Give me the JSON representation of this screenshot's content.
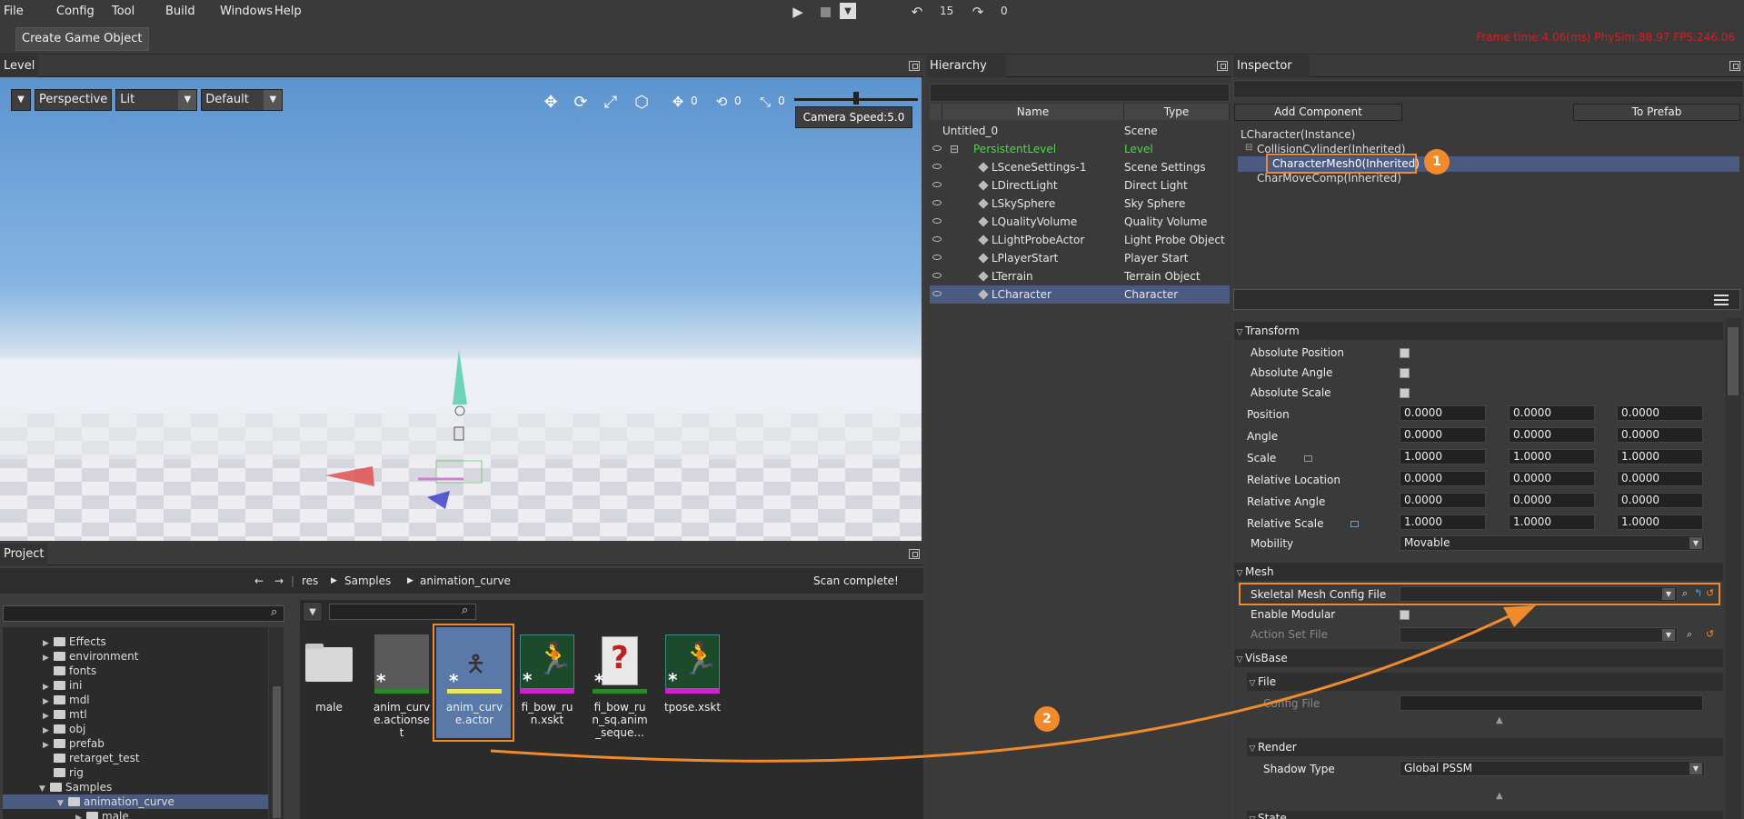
{
  "menu": [
    "File",
    "Config",
    "Tool",
    "Build",
    "Windows",
    "Help"
  ],
  "toolbar": {
    "undo_count": "15",
    "redo_count": "0",
    "create_game_object": "Create Game Object",
    "frame_stats": "Frame time:4.06(ms)  PhySim:88.97  FPS:246.06"
  },
  "level": {
    "tab": "Level",
    "view_mode": "Perspective",
    "lighting": "Lit",
    "preset": "Default",
    "counts": [
      "0",
      "0",
      "0"
    ],
    "camera_speed": "Camera Speed:5.0"
  },
  "project": {
    "tab": "Project",
    "breadcrumb": [
      "res",
      "Samples",
      "animation_curve"
    ],
    "status": "Scan complete!",
    "tree": [
      {
        "label": "Effects",
        "expandable": true
      },
      {
        "label": "environment",
        "expandable": true
      },
      {
        "label": "fonts",
        "expandable": false
      },
      {
        "label": "ini",
        "expandable": true
      },
      {
        "label": "mdl",
        "expandable": true
      },
      {
        "label": "mtl",
        "expandable": true
      },
      {
        "label": "obj",
        "expandable": true
      },
      {
        "label": "prefab",
        "expandable": true
      },
      {
        "label": "retarget_test",
        "expandable": false
      },
      {
        "label": "rig",
        "expandable": false
      },
      {
        "label": "Samples",
        "expandable": true
      },
      {
        "label": "animation_curve",
        "expandable": true
      },
      {
        "label": "male",
        "expandable": true
      }
    ],
    "assets": [
      {
        "name": "male",
        "kind": "folder"
      },
      {
        "name": "anim_curv\ne.actionse\nt",
        "kind": "actionset"
      },
      {
        "name": "anim_curv\ne.actor",
        "kind": "actor"
      },
      {
        "name": "fi_bow_ru\nn.xskt",
        "kind": "xskt"
      },
      {
        "name": "fi_bow_ru\nn_sq.anim\n_seque...",
        "kind": "anim"
      },
      {
        "name": "tpose.xskt",
        "kind": "xskt"
      }
    ]
  },
  "hierarchy": {
    "tab": "Hierarchy",
    "col_name": "Name",
    "col_type": "Type",
    "rows": [
      {
        "name": "Untitled_0",
        "type": "Scene"
      },
      {
        "name": "PersistentLevel",
        "type": "Level"
      },
      {
        "name": "LSceneSettings-1",
        "type": "Scene Settings"
      },
      {
        "name": "LDirectLight",
        "type": "Direct Light"
      },
      {
        "name": "LSkySphere",
        "type": "Sky Sphere"
      },
      {
        "name": "LQualityVolume",
        "type": "Quality Volume"
      },
      {
        "name": "LLightProbeActor",
        "type": "Light Probe Object"
      },
      {
        "name": "LPlayerStart",
        "type": "Player Start"
      },
      {
        "name": "LTerrain",
        "type": "Terrain Object"
      },
      {
        "name": "LCharacter",
        "type": "Character"
      }
    ]
  },
  "inspector": {
    "tab": "Inspector",
    "add_component": "Add Component",
    "to_prefab": "To Prefab",
    "components": [
      "LCharacter(Instance)",
      "CollisionCylinder(Inherited)",
      "CharacterMesh0(Inherited)",
      "CharMoveComp(Inherited)"
    ],
    "callouts": [
      "1",
      "2"
    ],
    "transform": {
      "title": "Transform",
      "abs_position": "Absolute Position",
      "abs_angle": "Absolute Angle",
      "abs_scale": "Absolute Scale",
      "position": {
        "label": "Position",
        "values": [
          "0.0000",
          "0.0000",
          "0.0000"
        ]
      },
      "angle": {
        "label": "Angle",
        "values": [
          "0.0000",
          "0.0000",
          "0.0000"
        ]
      },
      "scale": {
        "label": "Scale",
        "values": [
          "1.0000",
          "1.0000",
          "1.0000"
        ]
      },
      "rel_location": {
        "label": "Relative Location",
        "values": [
          "0.0000",
          "0.0000",
          "0.0000"
        ]
      },
      "rel_angle": {
        "label": "Relative Angle",
        "values": [
          "0.0000",
          "0.0000",
          "0.0000"
        ]
      },
      "rel_scale": {
        "label": "Relative Scale",
        "values": [
          "1.0000",
          "1.0000",
          "1.0000"
        ]
      },
      "mobility": {
        "label": "Mobility",
        "value": "Movable"
      }
    },
    "mesh": {
      "title": "Mesh",
      "skeletal_config": "Skeletal Mesh Config File",
      "enable_modular": "Enable Modular",
      "action_set": "Action Set File"
    },
    "visbase": {
      "title": "VisBase",
      "file_title": "File",
      "config_file": "Config File",
      "render_title": "Render",
      "shadow_type": {
        "label": "Shadow Type",
        "value": "Global PSSM"
      },
      "state_title": "State"
    }
  }
}
